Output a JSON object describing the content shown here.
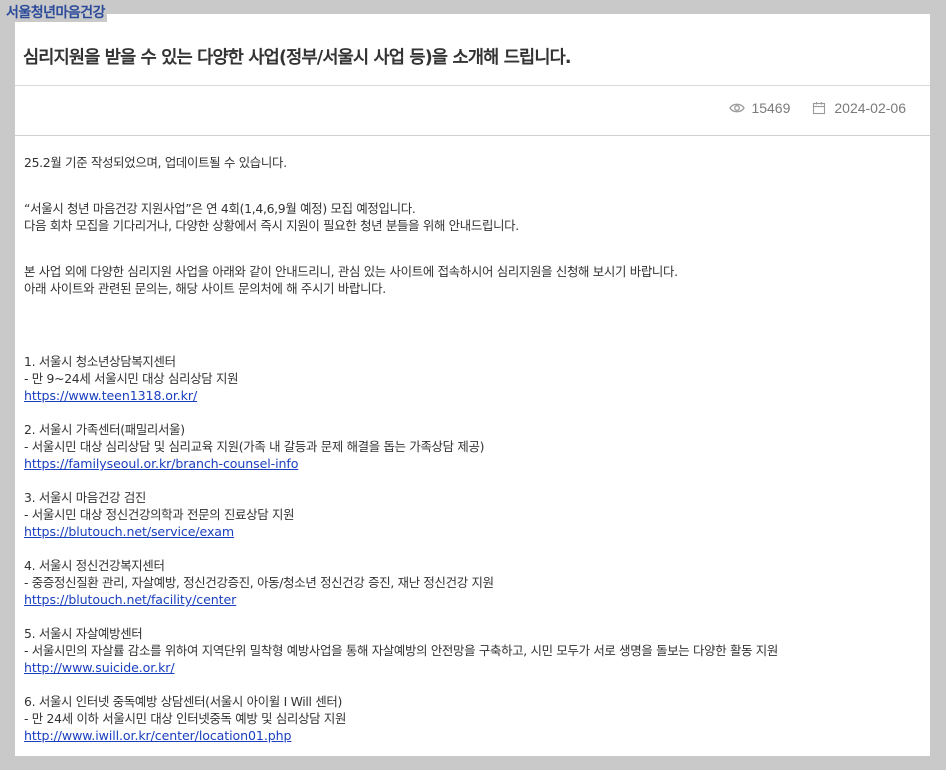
{
  "site": {
    "name": "서울청년마음건강"
  },
  "post": {
    "title": "심리지원을 받을 수 있는 다양한 사업(정부/서울시 사업 등)을 소개해 드립니다.",
    "views": "15469",
    "date": "2024-02-06"
  },
  "body": {
    "note": "25.2월 기준 작성되었으며, 업데이트될 수 있습니다.",
    "para1": [
      "“서울시 청년 마음건강 지원사업”은 연 4회(1,4,6,9월 예정) 모집 예정입니다.",
      "다음 회차 모집을 기다리거나, 다양한 상황에서 즉시 지원이 필요한 청년 분들을 위해 안내드립니다."
    ],
    "para2": [
      "본 사업 외에 다양한 심리지원 사업을 아래와 같이 안내드리니, 관심 있는 사이트에 접속하시어 심리지원을 신청해 보시기 바랍니다.",
      "아래 사이트와 관련된 문의는, 해당 사이트 문의처에 해 주시기 바랍니다."
    ],
    "items": [
      {
        "title": "1. 서울시 청소년상담복지센터",
        "desc": "- 만 9~24세 서울시민 대상 심리상담 지원",
        "link": "https://www.teen1318.or.kr/"
      },
      {
        "title": "2. 서울시 가족센터(패밀리서울)",
        "desc": "- 서울시민 대상 심리상담 및 심리교육 지원(가족 내 갈등과 문제 해결을 돕는 가족상담 제공)",
        "link": "https://familyseoul.or.kr/branch-counsel-info"
      },
      {
        "title": "3. 서울시 마음건강 검진",
        "desc": "- 서울시민 대상 정신건강의학과 전문의 진료상담 지원",
        "link": "https://blutouch.net/service/exam"
      },
      {
        "title": "4. 서울시 정신건강복지센터",
        "desc": "- 중증정신질환 관리, 자살예방, 정신건강증진, 아동/청소년 정신건강 증진, 재난 정신건강 지원",
        "link": "https://blutouch.net/facility/center"
      },
      {
        "title": "5. 서울시 자살예방센터",
        "desc": "- 서울시민의 자살률 감소를 위하여 지역단위 밀착형 예방사업을 통해 자살예방의 안전망을 구축하고, 시민 모두가 서로 생명을 돌보는 다양한 활동 지원",
        "link": "http://www.suicide.or.kr/"
      },
      {
        "title": "6. 서울시 인터넷 중독예방 상담센터(서울시 아이윌 I Will 센터)",
        "desc": "- 만 24세 이하 서울시민 대상 인터넷중독 예방 및 심리상담 지원",
        "link": "http://www.iwill.or.kr/center/location01.php"
      }
    ]
  },
  "icons": {
    "views": "eye-icon",
    "date": "calendar-icon"
  },
  "colors": {
    "site_name": "#2b4a9a",
    "link": "#1a3fbf",
    "backdrop": "#c9c9c9"
  }
}
